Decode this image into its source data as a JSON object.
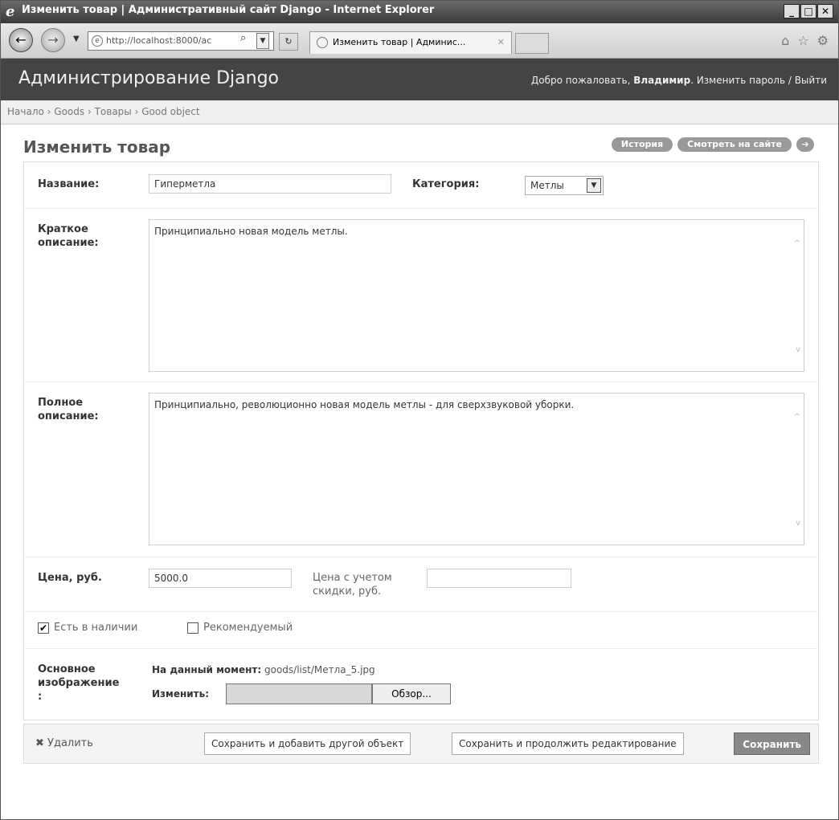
{
  "window": {
    "title": "Изменить товар | Административный сайт Django - Internet Explorer",
    "ie_logo": "e",
    "minimize": "_",
    "maximize": "□",
    "close": "✕"
  },
  "browser": {
    "back_icon": "←",
    "forward_icon": "→",
    "address": "http://localhost:8000/ac",
    "search_icon": "⌕",
    "refresh_icon": "↻",
    "tab_title": "Изменить товар | Админис...",
    "tab_close": "✕",
    "home_icon": "⌂",
    "favorites_icon": "☆",
    "tools_icon": "⚙"
  },
  "header": {
    "site_name": "Администрирование Django",
    "welcome": "Добро пожаловать, ",
    "username": "Владимир",
    "change_password": ". Изменить пароль",
    "sep": " / ",
    "logout": "Выйти"
  },
  "breadcrumbs": {
    "home": "Начало",
    "app": "Goods",
    "model": "Товары",
    "object": "Good object",
    "sep": " › "
  },
  "page": {
    "title": "Изменить товар"
  },
  "object_tools": {
    "history": "История",
    "view_on_site": "Смотреть на сайте",
    "arrow": "➔"
  },
  "form": {
    "name_label": "Название:",
    "name_value": "Гиперметла",
    "category_label": "Категория:",
    "category_value": "Метлы",
    "short_desc_label_1": "Краткое",
    "short_desc_label_2": "описание:",
    "short_desc_value": "Принципиально новая модель метлы.",
    "full_desc_label_1": "Полное",
    "full_desc_label_2": "описание:",
    "full_desc_value": "Принципиально, революционно новая модель метлы - для сверхзвуковой уборки.",
    "price_label": "Цена, руб.",
    "price_value": "5000.0",
    "discount_label_1": "Цена с учетом",
    "discount_label_2": "скидки, руб.",
    "discount_value": "",
    "in_stock_label": "Есть в наличии",
    "in_stock_checked": "✔",
    "featured_label": "Рекомендуемый",
    "image_label_1": "Основное",
    "image_label_2": "изображение",
    "image_label_3": ":",
    "current_label": "На данный момент:",
    "current_value": "goods/list/Метла_5.jpg",
    "change_label": "Изменить:",
    "browse_button": "Обзор..."
  },
  "submit_row": {
    "delete_icon": "✖",
    "delete": "Удалить",
    "save_add_another": "Сохранить и добавить другой объект",
    "save_continue": "Сохранить и продолжить редактирование",
    "save": "Сохранить"
  }
}
